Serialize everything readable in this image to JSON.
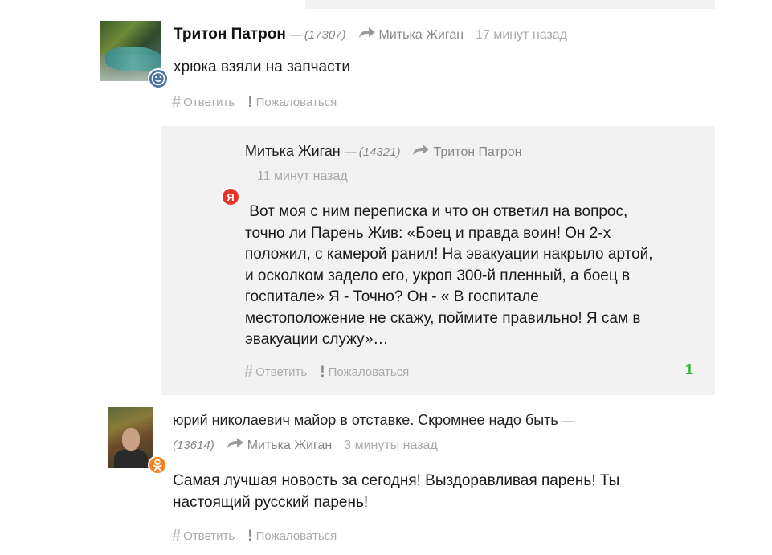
{
  "comments": [
    {
      "author": "Тритон Патрон",
      "dash": "—",
      "karma": "(17307)",
      "reply_to": "Митька Жиган",
      "time": "17 минут назад",
      "text": "хрюка взяли на запчасти",
      "reply_label": "Ответить",
      "report_label": "Пожаловаться",
      "badge": "smile-icon",
      "badge_color": "#4c75a3"
    },
    {
      "author": "Митька Жиган",
      "dash": "—",
      "karma": "(14321)",
      "reply_to": "Тритон Патрон",
      "time": "11 минут назад",
      "text_lines": [
        " Вот моя с ним переписка и что он ответил на вопрос,",
        "точно ли Парень Жив: «Боец и правда воин! Он 2-х",
        "положил, с камерой ранил! На эвакуации накрыло артой,",
        "и осколком задело его, укроп 300-й пленный, а боец в",
        "госпитале» Я - Точно? Он - « В госпитале",
        "местоположение не скажу, поймите правильно! Я сам в",
        "эвакуации служу»…"
      ],
      "reply_label": "Ответить",
      "report_label": "Пожаловаться",
      "likes": "1",
      "badge": "yandex-icon",
      "badge_letter": "Я",
      "badge_color": "#e63528",
      "likes_color": "#2eb82e"
    },
    {
      "author": "юрий николаевич майор в отставке. Скромнее надо быть",
      "dash": "—",
      "karma": "(13614)",
      "reply_to": "Митька Жиган",
      "time": "3 минуты назад",
      "text_lines": [
        "Самая лучшая новость за сегодня! Выздоравливая парень! Ты",
        "настоящий русский парень!"
      ],
      "reply_label": "Ответить",
      "report_label": "Пожаловаться",
      "badge": "odnoklassniki-icon",
      "badge_color": "#f58220"
    }
  ],
  "icons": {
    "reply_arrow": "↪",
    "hash": "#",
    "exclamation": "!"
  }
}
